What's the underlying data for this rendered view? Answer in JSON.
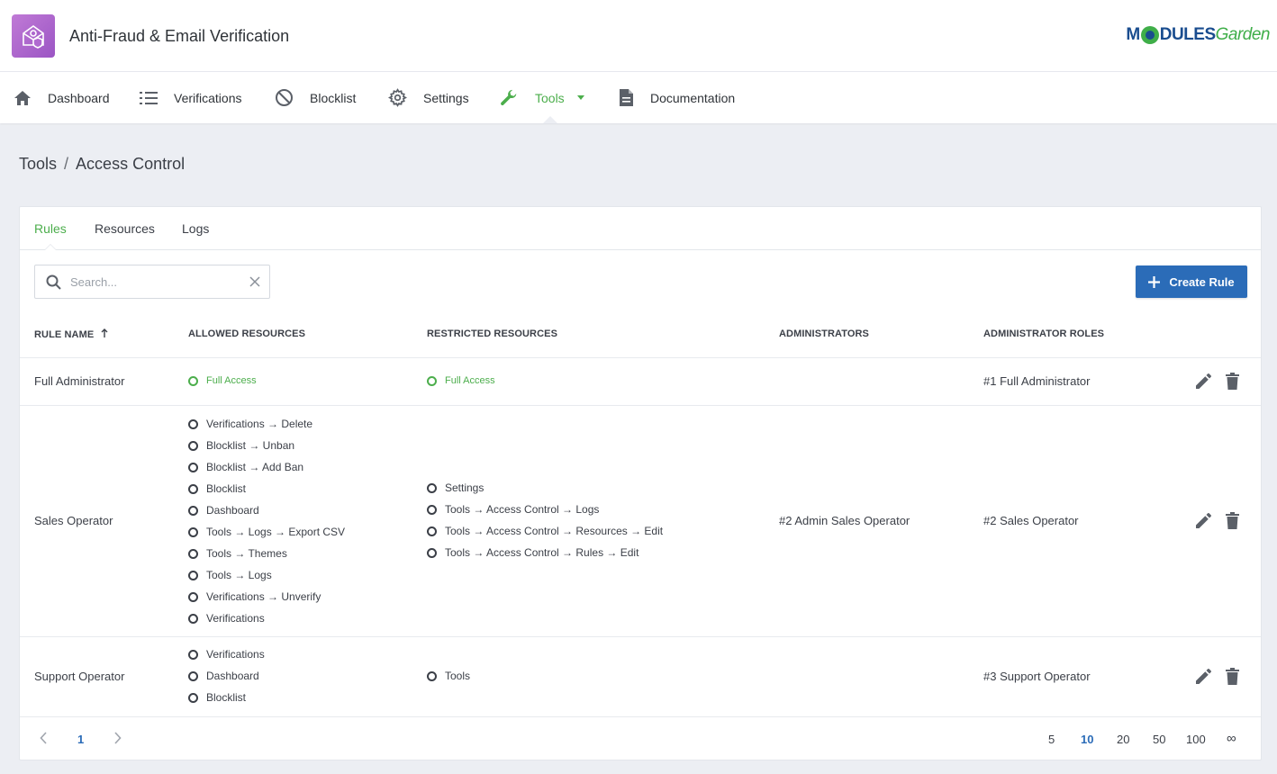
{
  "app": {
    "title": "Anti-Fraud & Email Verification",
    "brand_main": "M",
    "brand_rest": "DULES",
    "brand_garden": "Garden"
  },
  "nav": {
    "items": [
      {
        "label": "Dashboard",
        "icon": "home-icon"
      },
      {
        "label": "Verifications",
        "icon": "list-icon"
      },
      {
        "label": "Blocklist",
        "icon": "block-icon"
      },
      {
        "label": "Settings",
        "icon": "gear-icon"
      },
      {
        "label": "Tools",
        "icon": "wrench-icon",
        "active": true
      },
      {
        "label": "Documentation",
        "icon": "document-icon"
      }
    ]
  },
  "breadcrumb": {
    "parent": "Tools",
    "separator": "/",
    "current": "Access Control"
  },
  "tabs": {
    "rules": "Rules",
    "resources": "Resources",
    "logs": "Logs",
    "active": "Rules"
  },
  "search": {
    "placeholder": "Search...",
    "value": ""
  },
  "create_button": "Create Rule",
  "table": {
    "columns": [
      "RULE NAME",
      "ALLOWED RESOURCES",
      "RESTRICTED RESOURCES",
      "ADMINISTRATORS",
      "ADMINISTRATOR ROLES"
    ],
    "rows": [
      {
        "name": "Full Administrator",
        "allowed": [
          "Full Access"
        ],
        "restricted": [
          "Full Access"
        ],
        "administrators": "",
        "roles": "#1 Full Administrator"
      },
      {
        "name": "Sales Operator",
        "allowed": [
          "Verifications → Delete",
          "Blocklist → Unban",
          "Blocklist → Add Ban",
          "Blocklist",
          "Dashboard",
          "Tools → Logs → Export CSV",
          "Tools → Themes",
          "Tools → Logs",
          "Verifications → Unverify",
          "Verifications"
        ],
        "restricted": [
          "Settings",
          "Tools → Access Control → Logs",
          "Tools → Access Control → Resources → Edit",
          "Tools → Access Control → Rules → Edit"
        ],
        "administrators": "#2 Admin Sales Operator",
        "roles": "#2 Sales Operator"
      },
      {
        "name": "Support Operator",
        "allowed": [
          "Verifications",
          "Dashboard",
          "Blocklist"
        ],
        "restricted": [
          "Tools"
        ],
        "administrators": "",
        "roles": "#3 Support Operator"
      }
    ]
  },
  "pagination": {
    "current_page": "1",
    "page_sizes": [
      "5",
      "10",
      "20",
      "50",
      "100",
      "∞"
    ],
    "selected_size": "10"
  },
  "colors": {
    "accent_green": "#4cae4c",
    "primary_blue": "#2b6cb8",
    "logo_purple": "#b06ad0"
  }
}
